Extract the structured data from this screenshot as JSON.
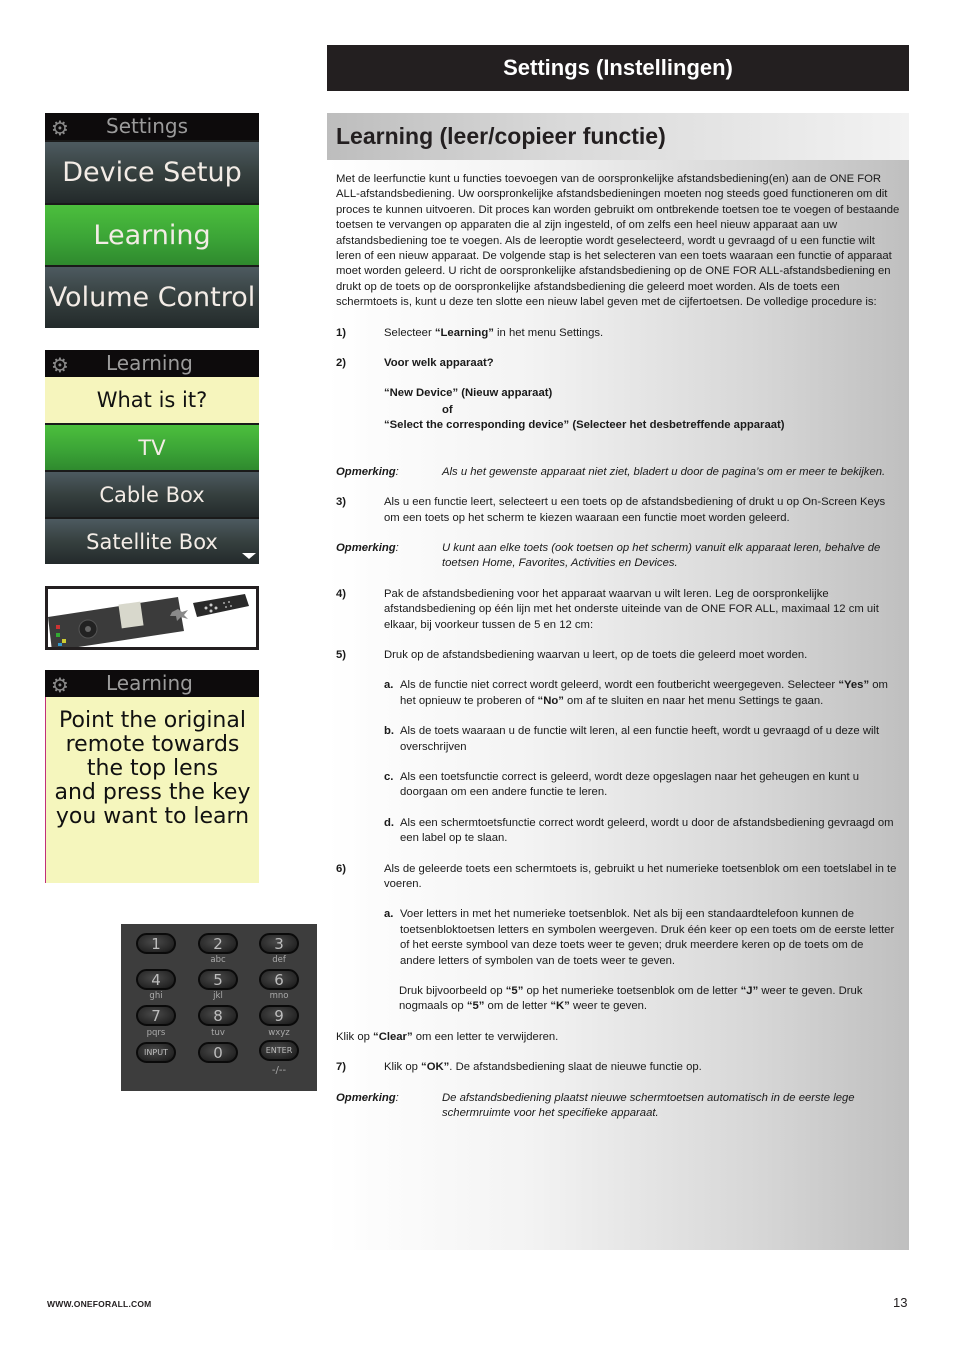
{
  "header": {
    "title": "Settings (Instellingen)"
  },
  "section": {
    "title": "Learning (leer/copieer functie)"
  },
  "intro": "Met de leerfunctie kunt u functies toevoegen van de oorspronkelijke afstandsbediening(en) aan de ONE FOR ALL-afstandsbediening. Uw oorspronkelijke afstandsbedieningen moeten nog steeds goed functioneren om dit proces te kunnen uitvoeren. Dit proces kan worden gebruikt om ontbrekende toetsen toe te voegen of bestaande toetsen te vervangen op apparaten die al zijn ingesteld, of om zelfs een heel nieuw apparaat aan uw afstandsbediening toe te voegen. Als de leeroptie wordt geselecteerd, wordt u gevraagd of u een functie wilt leren of een nieuw apparaat. De volgende stap is het selecteren van een toets waaraan een functie of apparaat moet worden geleerd. U richt de oorspronkelijke afstandsbediening op de ONE FOR ALL-afstandsbediening en drukt op de toets op de oorspronkelijke afstandsbediening die geleerd moet worden. Als de toets een schermtoets is, kunt u deze ten slotte een nieuw label geven met de cijfertoetsen. De volledige procedure is:",
  "steps": {
    "s1": {
      "num": "1)",
      "pre": "Selecteer ",
      "bold": "“Learning”",
      "post": " in het menu Settings."
    },
    "s2": {
      "num": "2)",
      "title": "Voor welk apparaat?",
      "opt1": "“New Device” (Nieuw apparaat)",
      "or": "of",
      "opt2": "“Select the corresponding device” (Selecteer het desbetreffende apparaat)"
    },
    "note1": {
      "label": "Opmerking",
      "colon": ":",
      "text": "Als u het gewenste apparaat niet ziet, bladert u door de pagina’s om er meer te bekijken."
    },
    "s3": {
      "num": "3)",
      "text": "Als u een functie leert, selecteert u een toets op de afstandsbediening of drukt u op On-Screen Keys om een toets op het scherm te kiezen waaraan een functie moet worden geleerd."
    },
    "note2": {
      "label": "Opmerking",
      "colon": ":",
      "text": "U kunt aan elke toets (ook toetsen op het scherm) vanuit elk apparaat leren, behalve de toetsen Home, Favorites, Activities en Devices."
    },
    "s4": {
      "num": "4)",
      "text": "Pak de afstandsbediening voor het apparaat waarvan u wilt leren. Leg de oorspronkelijke afstandsbediening op één lijn met het onderste uiteinde van de ONE FOR ALL, maximaal 12 cm uit elkaar, bij voorkeur tussen de 5 en 12 cm:"
    },
    "s5": {
      "num": "5)",
      "text": "Druk op de afstandsbediening waarvan u leert, op de toets die geleerd moet worden."
    },
    "s5a": {
      "letter": "a.",
      "pre": "Als de functie niet correct wordt geleerd, wordt een foutbericht weergegeven. Selecteer ",
      "yes": "“Yes”",
      "mid": " om het opnieuw te proberen of ",
      "no": "“No”",
      "post": " om af te sluiten en naar het menu Settings te gaan."
    },
    "s5b": {
      "letter": "b.",
      "text": "Als de toets waaraan u de functie wilt leren, al een functie heeft, wordt u gevraagd of u deze wilt overschrijven"
    },
    "s5c": {
      "letter": "c.",
      "text": "Als een toetsfunctie correct is geleerd, wordt deze opgeslagen naar het geheugen en kunt u doorgaan om een andere functie te leren."
    },
    "s5d": {
      "letter": "d.",
      "text": "Als een schermtoetsfunctie correct wordt geleerd, wordt u door de afstandsbediening gevraagd om een label op te slaan."
    },
    "s6": {
      "num": "6)",
      "text": "Als de geleerde toets een schermtoets is, gebruikt u het numerieke toetsenblok om een toetslabel in te voeren."
    },
    "s6a": {
      "letter": "a.",
      "text": "Voer letters in met het numerieke toetsenblok. Net als bij een standaardtelefoon kunnen de toetsenbloktoetsen letters en symbolen weergeven. Druk één keer op een toets om de eerste letter of het eerste symbool van deze toets weer te geven; druk meerdere keren op de toets om de andere letters of symbolen van de toets weer te geven."
    },
    "s6ex": {
      "p1": "Druk bijvoorbeeld op ",
      "b1": "“5”",
      "p2": " op het numerieke toetsenblok om de letter ",
      "b2": "“J”",
      "p3": " weer te geven. Druk nogmaals op ",
      "b3": "“5”",
      "p4": " om de letter ",
      "b4": "“K”",
      "p5": " weer te geven."
    },
    "clear": {
      "pre": "Klik op ",
      "bold": "“Clear”",
      "post": " om een letter te verwijderen."
    },
    "s7": {
      "num": "7)",
      "pre": "Klik op ",
      "bold": "“OK”",
      "post": ". De afstandsbediening slaat de nieuwe functie op."
    },
    "note3": {
      "label": "Opmerking",
      "colon": ":",
      "text": "De afstandsbediening plaatst nieuwe schermtoetsen automatisch in de eerste lege schermruimte voor het specifieke apparaat."
    }
  },
  "screens": {
    "settings": {
      "title": "Settings",
      "items": [
        "Device Setup",
        "Learning",
        "Volume Control"
      ],
      "selected": "Learning"
    },
    "learning_device": {
      "title": "Learning",
      "prompt": "What is it?",
      "items": [
        "TV",
        "Cable Box",
        "Satellite Box"
      ],
      "selected": "TV"
    },
    "learning_point": {
      "title": "Learning",
      "lines": [
        "Point the original",
        "remote towards",
        "the top lens",
        "and press the key",
        "you want to learn"
      ]
    }
  },
  "keypad": {
    "keys": [
      "1",
      "2",
      "3",
      "4",
      "5",
      "6",
      "7",
      "8",
      "9",
      "INPUT",
      "0",
      "ENTER"
    ],
    "sublabels": [
      "abc",
      "def",
      "ghi",
      "jkl",
      "mno",
      "pqrs",
      "tuv",
      "wxyz",
      "-/--"
    ]
  },
  "colors": {
    "green": "#3aa236",
    "yellow": "#f6f5bd",
    "dark": "#231f20"
  },
  "footer": {
    "url": "WWW.ONEFORALL.COM",
    "page": "13"
  }
}
